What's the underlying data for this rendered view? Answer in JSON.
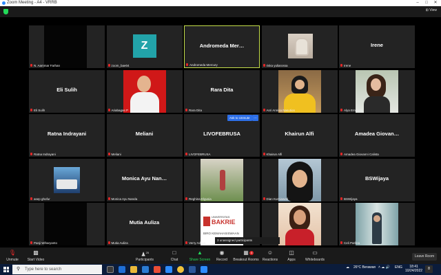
{
  "window": {
    "title": "Zoom Meeting - A4 - VRRB",
    "view_label": "⊞ View"
  },
  "tiles": [
    {
      "label": "N. Aammar Farhan",
      "big": "",
      "kind": "video-dark"
    },
    {
      "label": "zoom_bae04",
      "big": "Z",
      "kind": "avatar"
    },
    {
      "label": "Andromeda Mercury",
      "big": "Andromeda Mer…",
      "kind": "name",
      "active": true
    },
    {
      "label": "riska yuliarossa",
      "big": "",
      "kind": "photo-hijab"
    },
    {
      "label": "Irene",
      "big": "Irene",
      "kind": "name"
    },
    {
      "label": "Eli Sulih",
      "big": "Eli Sulih",
      "kind": "name"
    },
    {
      "label": "Ariabagas P",
      "big": "",
      "kind": "photo-red"
    },
    {
      "label": "Rara Dita",
      "big": "Rara Dita",
      "kind": "name"
    },
    {
      "label": "Asri Annisa Nasution",
      "big": "",
      "kind": "video-hijab-yellow"
    },
    {
      "label": "Alya Ernanda",
      "big": "",
      "kind": "photo-woman"
    },
    {
      "label": "Ratna Indrayani",
      "big": "Ratna Indrayani",
      "kind": "name"
    },
    {
      "label": "Meliani",
      "big": "Meliani",
      "kind": "name"
    },
    {
      "label": "LIVOFEBRUSA",
      "big": "LIVOFEBRUSA",
      "kind": "name"
    },
    {
      "label": "Khairun Alfi",
      "big": "Khairun Alfi",
      "kind": "name"
    },
    {
      "label": "Amadea Giovanni Calista",
      "big": "Amadea Giovan…",
      "kind": "name"
    },
    {
      "label": "asep ghofur",
      "big": "",
      "kind": "photo-group"
    },
    {
      "label": "Monica Ayu Nanda",
      "big": "Monica Ayu Nan…",
      "kind": "name"
    },
    {
      "label": "Reghina Elgusia",
      "big": "",
      "kind": "photo-garden"
    },
    {
      "label": "Dian Kurniawati",
      "big": "",
      "kind": "video-hijab-black"
    },
    {
      "label": "BSWijaya",
      "big": "BSWijaya",
      "kind": "name"
    },
    {
      "label": "Panji Wiharyanto",
      "big": "",
      "kind": "video-dark"
    },
    {
      "label": "Mutia Auliza",
      "big": "Mutia Auliza",
      "kind": "name"
    },
    {
      "label": "Verry Aditya",
      "big": "",
      "kind": "bakrie"
    },
    {
      "label": "",
      "big": "",
      "kind": "photo-anchor"
    },
    {
      "label": "Celi Parlina",
      "big": "",
      "kind": "photo-train"
    }
  ],
  "bakrie": {
    "line1": "UNIVERSITAS",
    "line2": "BAKRIE",
    "line3": "BIRO KEMAHASISWAAN"
  },
  "ask_unmute": "Ask to Unmute",
  "more": "…",
  "unassigned": "3 unassigned participants",
  "toolbar": {
    "unmute": "Unmute",
    "start_video": "Start Video",
    "participants": "Participants",
    "participants_count": "25",
    "chat": "Chat",
    "share": "Share Screen",
    "record": "Record",
    "breakout": "Breakout Rooms",
    "breakout_badge": "4",
    "reactions": "Reactions",
    "apps": "Apps",
    "whiteboards": "Whiteboards",
    "leave": "Leave Room"
  },
  "taskbar": {
    "search_placeholder": "Type here to search",
    "weather": "26°C  Berawan",
    "lang": "ENG",
    "time": "18:41",
    "date": "10/24/2022",
    "notif_count": "8"
  }
}
